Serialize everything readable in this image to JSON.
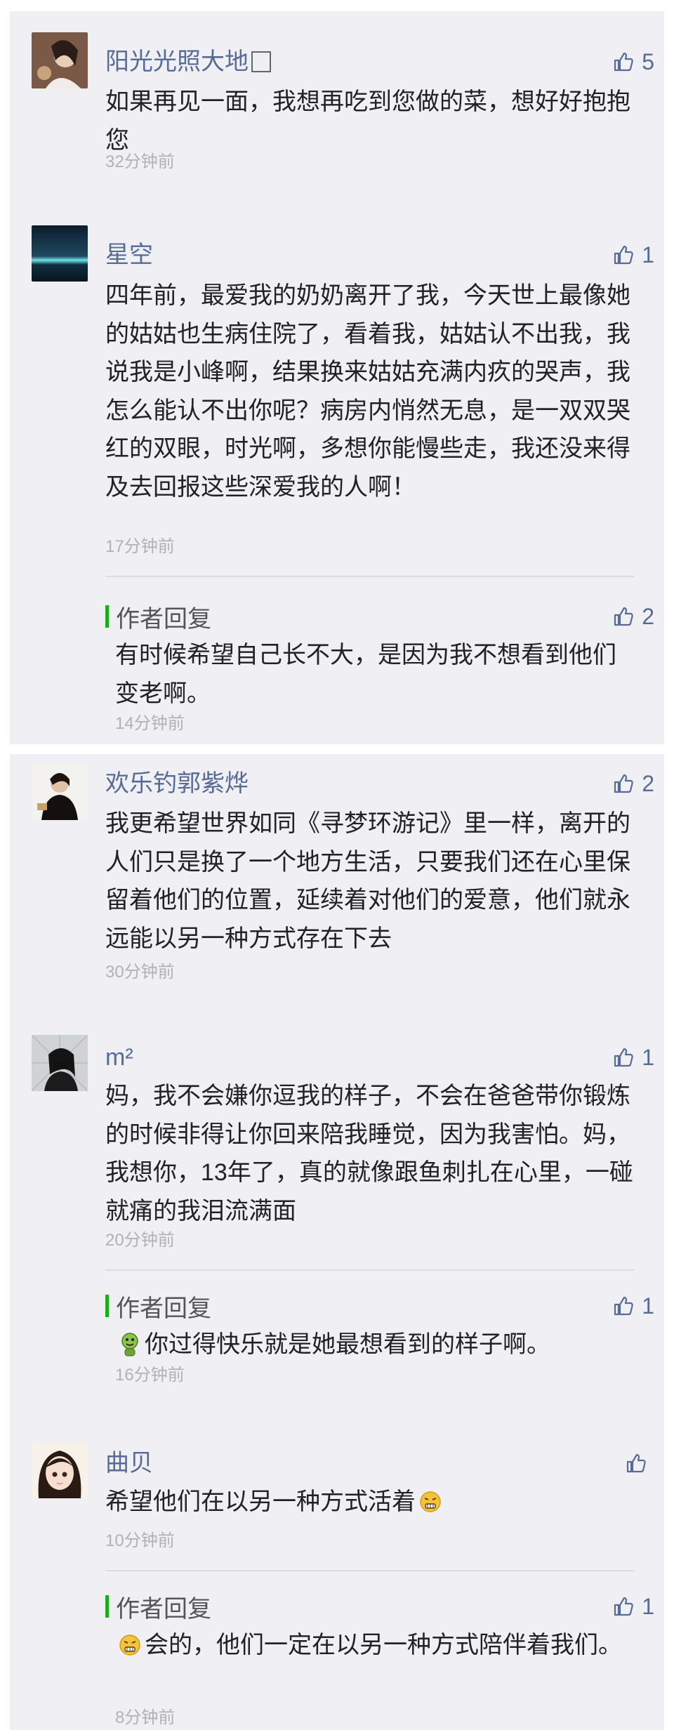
{
  "comments": [
    {
      "name": "阳光光照大地",
      "text": "如果再见一面，我想再吃到您做的菜，想好好抱抱您",
      "time": "32分钟前",
      "likes": "5"
    },
    {
      "name": "星空",
      "text": "四年前，最爱我的奶奶离开了我，今天世上最像她的姑姑也生病住院了，看着我，姑姑认不出我，我说我是小峰啊，结果换来姑姑充满内疚的哭声，我怎么能认不出你呢？病房内悄然无息，是一双双哭红的双眼，时光啊，多想你能慢些走，我还没来得及去回报这些深爱我的人啊！",
      "time": "17分钟前",
      "likes": "1",
      "reply": {
        "title": "作者回复",
        "text": "有时候希望自己长不大，是因为我不想看到他们变老啊。",
        "time": "14分钟前",
        "likes": "2"
      }
    },
    {
      "name": "欢乐钓郭紫烨",
      "text": "我更希望世界如同《寻梦环游记》里一样，离开的人们只是换了一个地方生活，只要我们还在心里保留着他们的位置，延续着对他们的爱意，他们就永远能以另一种方式存在下去",
      "time": "30分钟前",
      "likes": "2"
    },
    {
      "name": "m²",
      "text": "妈，我不会嫌你逗我的样子，不会在爸爸带你锻炼的时候非得让你回来陪我睡觉，因为我害怕。妈，我想你，13年了，真的就像跟鱼刺扎在心里，一碰就痛的我泪流满面",
      "time": "20分钟前",
      "likes": "1",
      "reply": {
        "title": "作者回复",
        "text": "你过得快乐就是她最想看到的样子啊。",
        "time": "16分钟前",
        "likes": "1"
      }
    },
    {
      "name": "曲贝",
      "text": "希望他们在以另一种方式活着",
      "time": "10分钟前",
      "likes": "",
      "reply": {
        "title": "作者回复",
        "text": "会的，他们一定在以另一种方式陪伴着我们。",
        "time": "8分钟前",
        "likes": "1"
      }
    }
  ],
  "colors": {
    "link": "#576b95",
    "card_bg": "#efeff4",
    "reply_bar": "#1aad19",
    "time": "#b2b2b2"
  },
  "icons": {
    "like": "thumbs-up-icon",
    "emoji_green": "green-smiley-emoji",
    "emoji_frown": "grimace-emoji"
  }
}
